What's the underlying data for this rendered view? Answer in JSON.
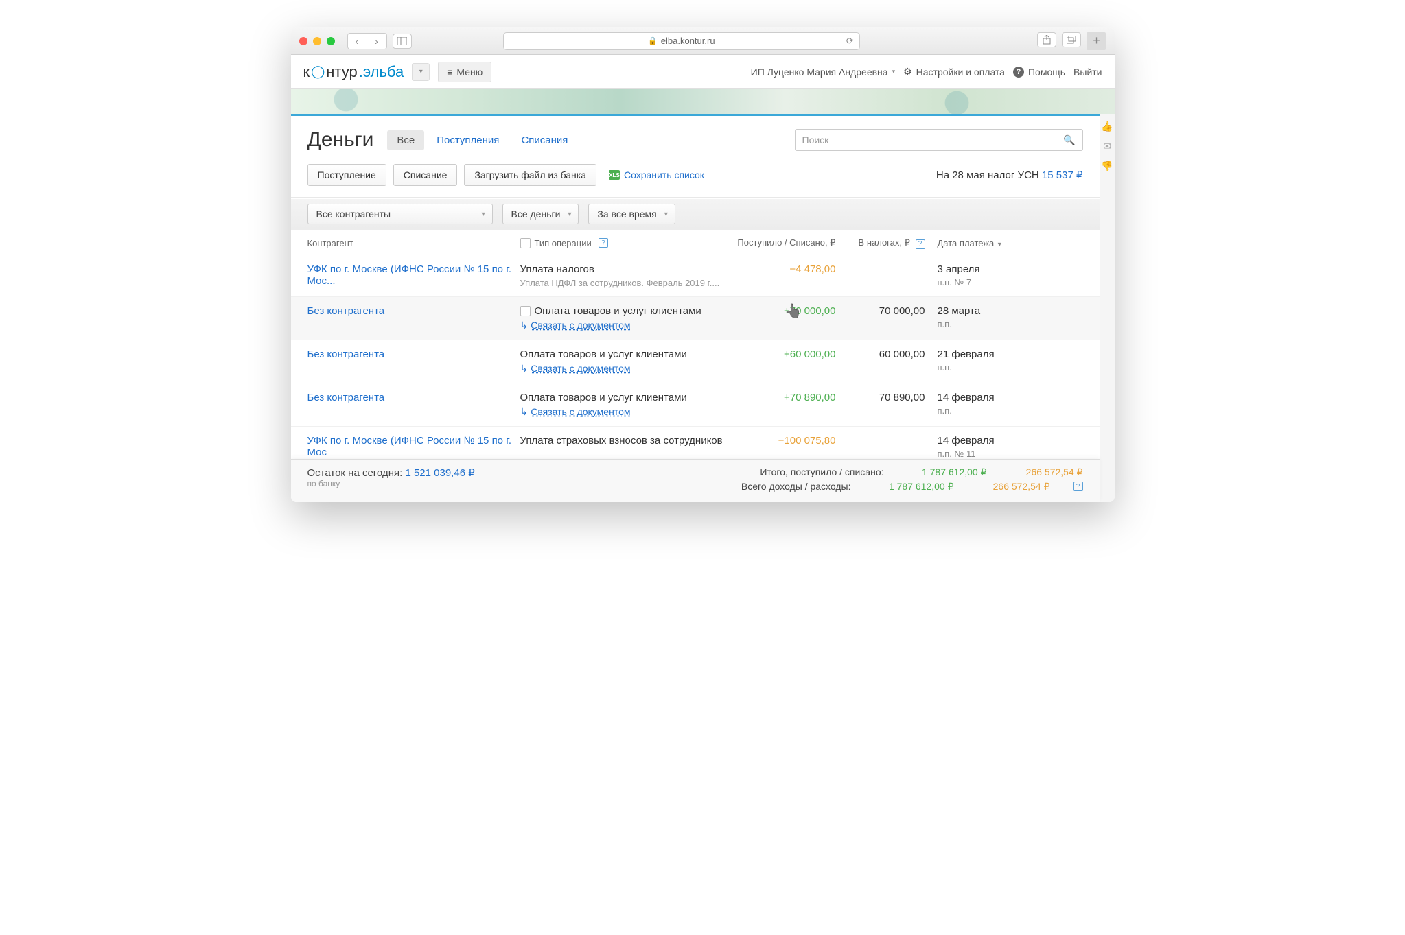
{
  "browser": {
    "url": "elba.kontur.ru"
  },
  "header": {
    "logo_brand": "контур",
    "logo_product": ".эльба",
    "menu": "Меню",
    "user": "ИП Луценко Мария Андреевна",
    "settings": "Настройки и оплата",
    "help": "Помощь",
    "logout": "Выйти"
  },
  "page": {
    "title": "Деньги",
    "tabs": {
      "all": "Все",
      "income": "Поступления",
      "outcome": "Списания"
    },
    "search_placeholder": "Поиск"
  },
  "toolbar": {
    "income_btn": "Поступление",
    "outcome_btn": "Списание",
    "upload_btn": "Загрузить файл из банка",
    "save_list": "Сохранить список",
    "tax_notice_prefix": "На 28 мая налог УСН ",
    "tax_amount": "15 537 ₽"
  },
  "filters": {
    "counterparty": "Все контрагенты",
    "money": "Все деньги",
    "period": "За все время"
  },
  "columns": {
    "agent": "Контрагент",
    "op": "Тип операции",
    "amount": "Поступило / Списано, ₽",
    "tax": "В налогах, ₽",
    "date": "Дата платежа"
  },
  "rows": [
    {
      "agent": "УФК по г. Москве (ИФНС России № 15 по г. Мос...",
      "op": "Уплата налогов",
      "op_sub": "Уплата НДФЛ за сотрудников. Февраль 2019 г....",
      "amount": "−4 478,00",
      "amount_class": "amt-neg",
      "tax": "",
      "date": "3 апреля",
      "date_sub": "п.п. № 7",
      "show_check": false,
      "show_link": false
    },
    {
      "agent": "Без контрагента",
      "op": "Оплата товаров и услуг клиентами",
      "link": "Связать с документом",
      "amount": "+70 000,00",
      "amount_class": "amt-pos",
      "tax": "70 000,00",
      "date": "28 марта",
      "date_sub": "п.п.",
      "show_check": true,
      "show_link": true,
      "hover": true,
      "cursor": true
    },
    {
      "agent": "Без контрагента",
      "op": "Оплата товаров и услуг клиентами",
      "link": "Связать с документом",
      "amount": "+60 000,00",
      "amount_class": "amt-pos",
      "tax": "60 000,00",
      "date": "21 февраля",
      "date_sub": "п.п.",
      "show_check": false,
      "show_link": true
    },
    {
      "agent": "Без контрагента",
      "op": "Оплата товаров и услуг клиентами",
      "link": "Связать с документом",
      "amount": "+70 890,00",
      "amount_class": "amt-pos",
      "tax": "70 890,00",
      "date": "14 февраля",
      "date_sub": "п.п.",
      "show_check": false,
      "show_link": true
    },
    {
      "agent": "УФК по г. Москве (ИФНС России № 15 по г. Мос",
      "op": "Уплата страховых взносов за сотрудников",
      "amount": "−100 075,80",
      "amount_class": "amt-neg",
      "tax": "",
      "date": "14 февраля",
      "date_sub": "п.п. № 11",
      "show_check": false,
      "show_link": false,
      "truncated": true
    }
  ],
  "footer": {
    "balance_label": "Остаток на сегодня:",
    "balance": "1 521 039,46 ₽",
    "balance_sub": "по банку",
    "total_label": "Итого, поступило / списано:",
    "total_in": "1 787 612,00 ₽",
    "total_out": "266 572,54 ₽",
    "all_label": "Всего доходы / расходы:",
    "all_in": "1 787 612,00 ₽",
    "all_out": "266 572,54 ₽"
  }
}
